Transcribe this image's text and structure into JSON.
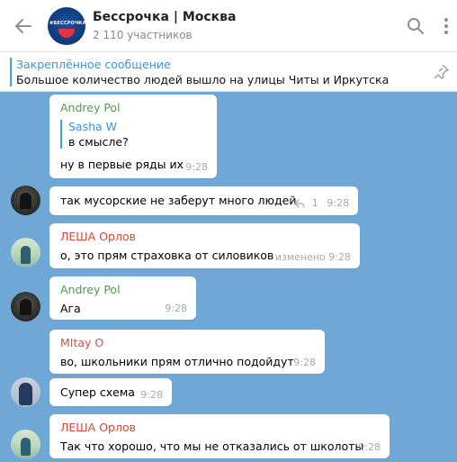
{
  "header": {
    "title": "Бессрочка | Москва",
    "members": "2 110 участников",
    "avatar_text": "#БЕССРОЧКА"
  },
  "pinned": {
    "title": "Закреплённое сообщение",
    "text": "Большое количество людей вышло на улицы Читы и Иркутска"
  },
  "messages": [
    {
      "author": "Andrey Pol",
      "author_color": "#4f9b4a",
      "quote_author": "Sasha W",
      "quote_text": "в смысле?",
      "text": "ну в первые ряды их",
      "time": "9:28"
    },
    {
      "text": "так  мусорские не заберут много людей",
      "replies": "1",
      "time": "9:28"
    },
    {
      "author": "ЛЕША Орлов",
      "author_color": "#cf4a37",
      "text": "о, это прям страховка от силовиков",
      "time": "изменено 9:28"
    },
    {
      "author": "Andrey Pol",
      "author_color": "#4f9b4a",
      "text": "Ага",
      "time": "9:28"
    },
    {
      "author": "MItay O",
      "author_color": "#c0584d",
      "text": "во, школьники прям отлично подойдут",
      "time": "9:28"
    },
    {
      "text": "Супер схема",
      "time": "9:28"
    },
    {
      "author": "ЛЕША Орлов",
      "author_color": "#cf4a37",
      "text": "Так что хорошо, что мы не отказались от школоты",
      "time": "9:28"
    }
  ],
  "colors": {
    "background": "#6fa8d6",
    "accent": "#3aa3e3"
  },
  "icons": [
    "back-arrow-icon",
    "search-icon",
    "more-vertical-icon",
    "unpin-icon",
    "reply-icon"
  ]
}
